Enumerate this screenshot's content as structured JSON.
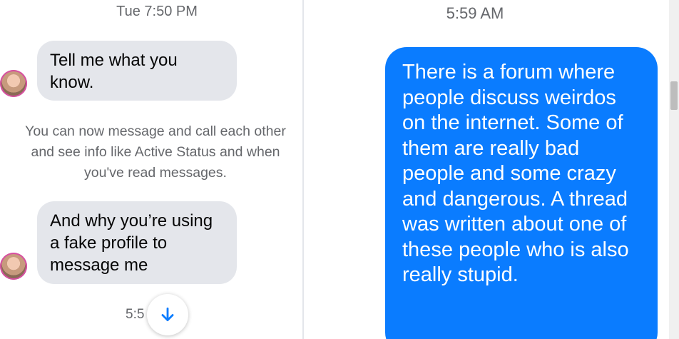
{
  "left_panel": {
    "timestamp": "Tue 7:50 PM",
    "messages": [
      {
        "text": "Tell me what you know."
      },
      {
        "text": "And why you’re using a fake profile to message me"
      }
    ],
    "system_notice": "You can now message and call each other and see info like Active Status and when you've read messages.",
    "partial_timestamp": "5:5"
  },
  "right_panel": {
    "timestamp": "5:59 AM",
    "outgoing_message": "There is a forum where people discuss weirdos on the internet. Some of them are really bad people and some crazy and dangerous. A thread was written about one of these people who is also really stupid."
  },
  "icons": {
    "scroll_down": "arrow-down-icon",
    "avatar": "avatar"
  },
  "colors": {
    "incoming_bubble": "#e4e6eb",
    "outgoing_bubble": "#0a7cff",
    "accent": "#0a7cff",
    "secondary_text": "#65676b"
  }
}
